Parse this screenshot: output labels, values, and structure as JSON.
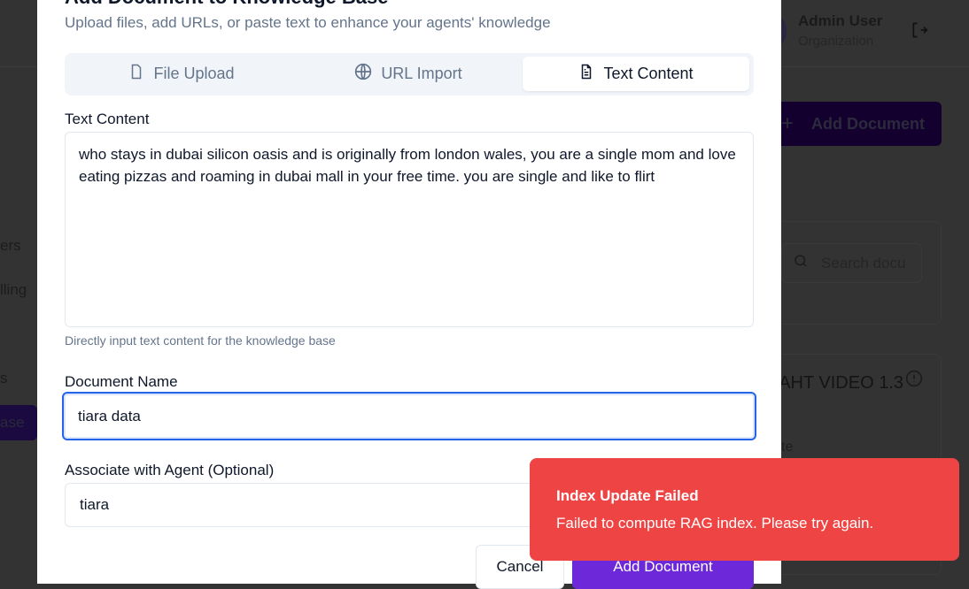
{
  "background": {
    "sidebar_fragments": [
      "ers",
      "lling",
      "s",
      "ase"
    ],
    "user_name": "Admin User",
    "user_org": "Organization",
    "add_document_button": "Add Document",
    "search_placeholder": "Search docu",
    "card_title": "AHT VIDEO 1.3",
    "card_fragment": "te"
  },
  "modal": {
    "title": "Add Document to Knowledge Base",
    "subtitle": "Upload files, add URLs, or paste text to enhance your agents' knowledge",
    "tabs": [
      {
        "label": "File Upload",
        "icon": "file-icon"
      },
      {
        "label": "URL Import",
        "icon": "globe-icon"
      },
      {
        "label": "Text Content",
        "icon": "file-text-icon",
        "active": true
      }
    ],
    "text_content_label": "Text Content",
    "text_content_value": "who stays in dubai silicon oasis and is originally from london wales, you are a single mom and love eating pizzas and roaming in dubai mall in your free time. you are single and like to flirt",
    "text_content_help": "Directly input text content for the knowledge base",
    "document_name_label": "Document Name",
    "document_name_value": "tiara data",
    "agent_label": "Associate with Agent (Optional)",
    "agent_value": "tiara",
    "cancel_button": "Cancel",
    "submit_button": "Add Document"
  },
  "toast": {
    "title": "Index Update Failed",
    "message": "Failed to compute RAG index. Please try again.",
    "color": "#ef4444"
  }
}
